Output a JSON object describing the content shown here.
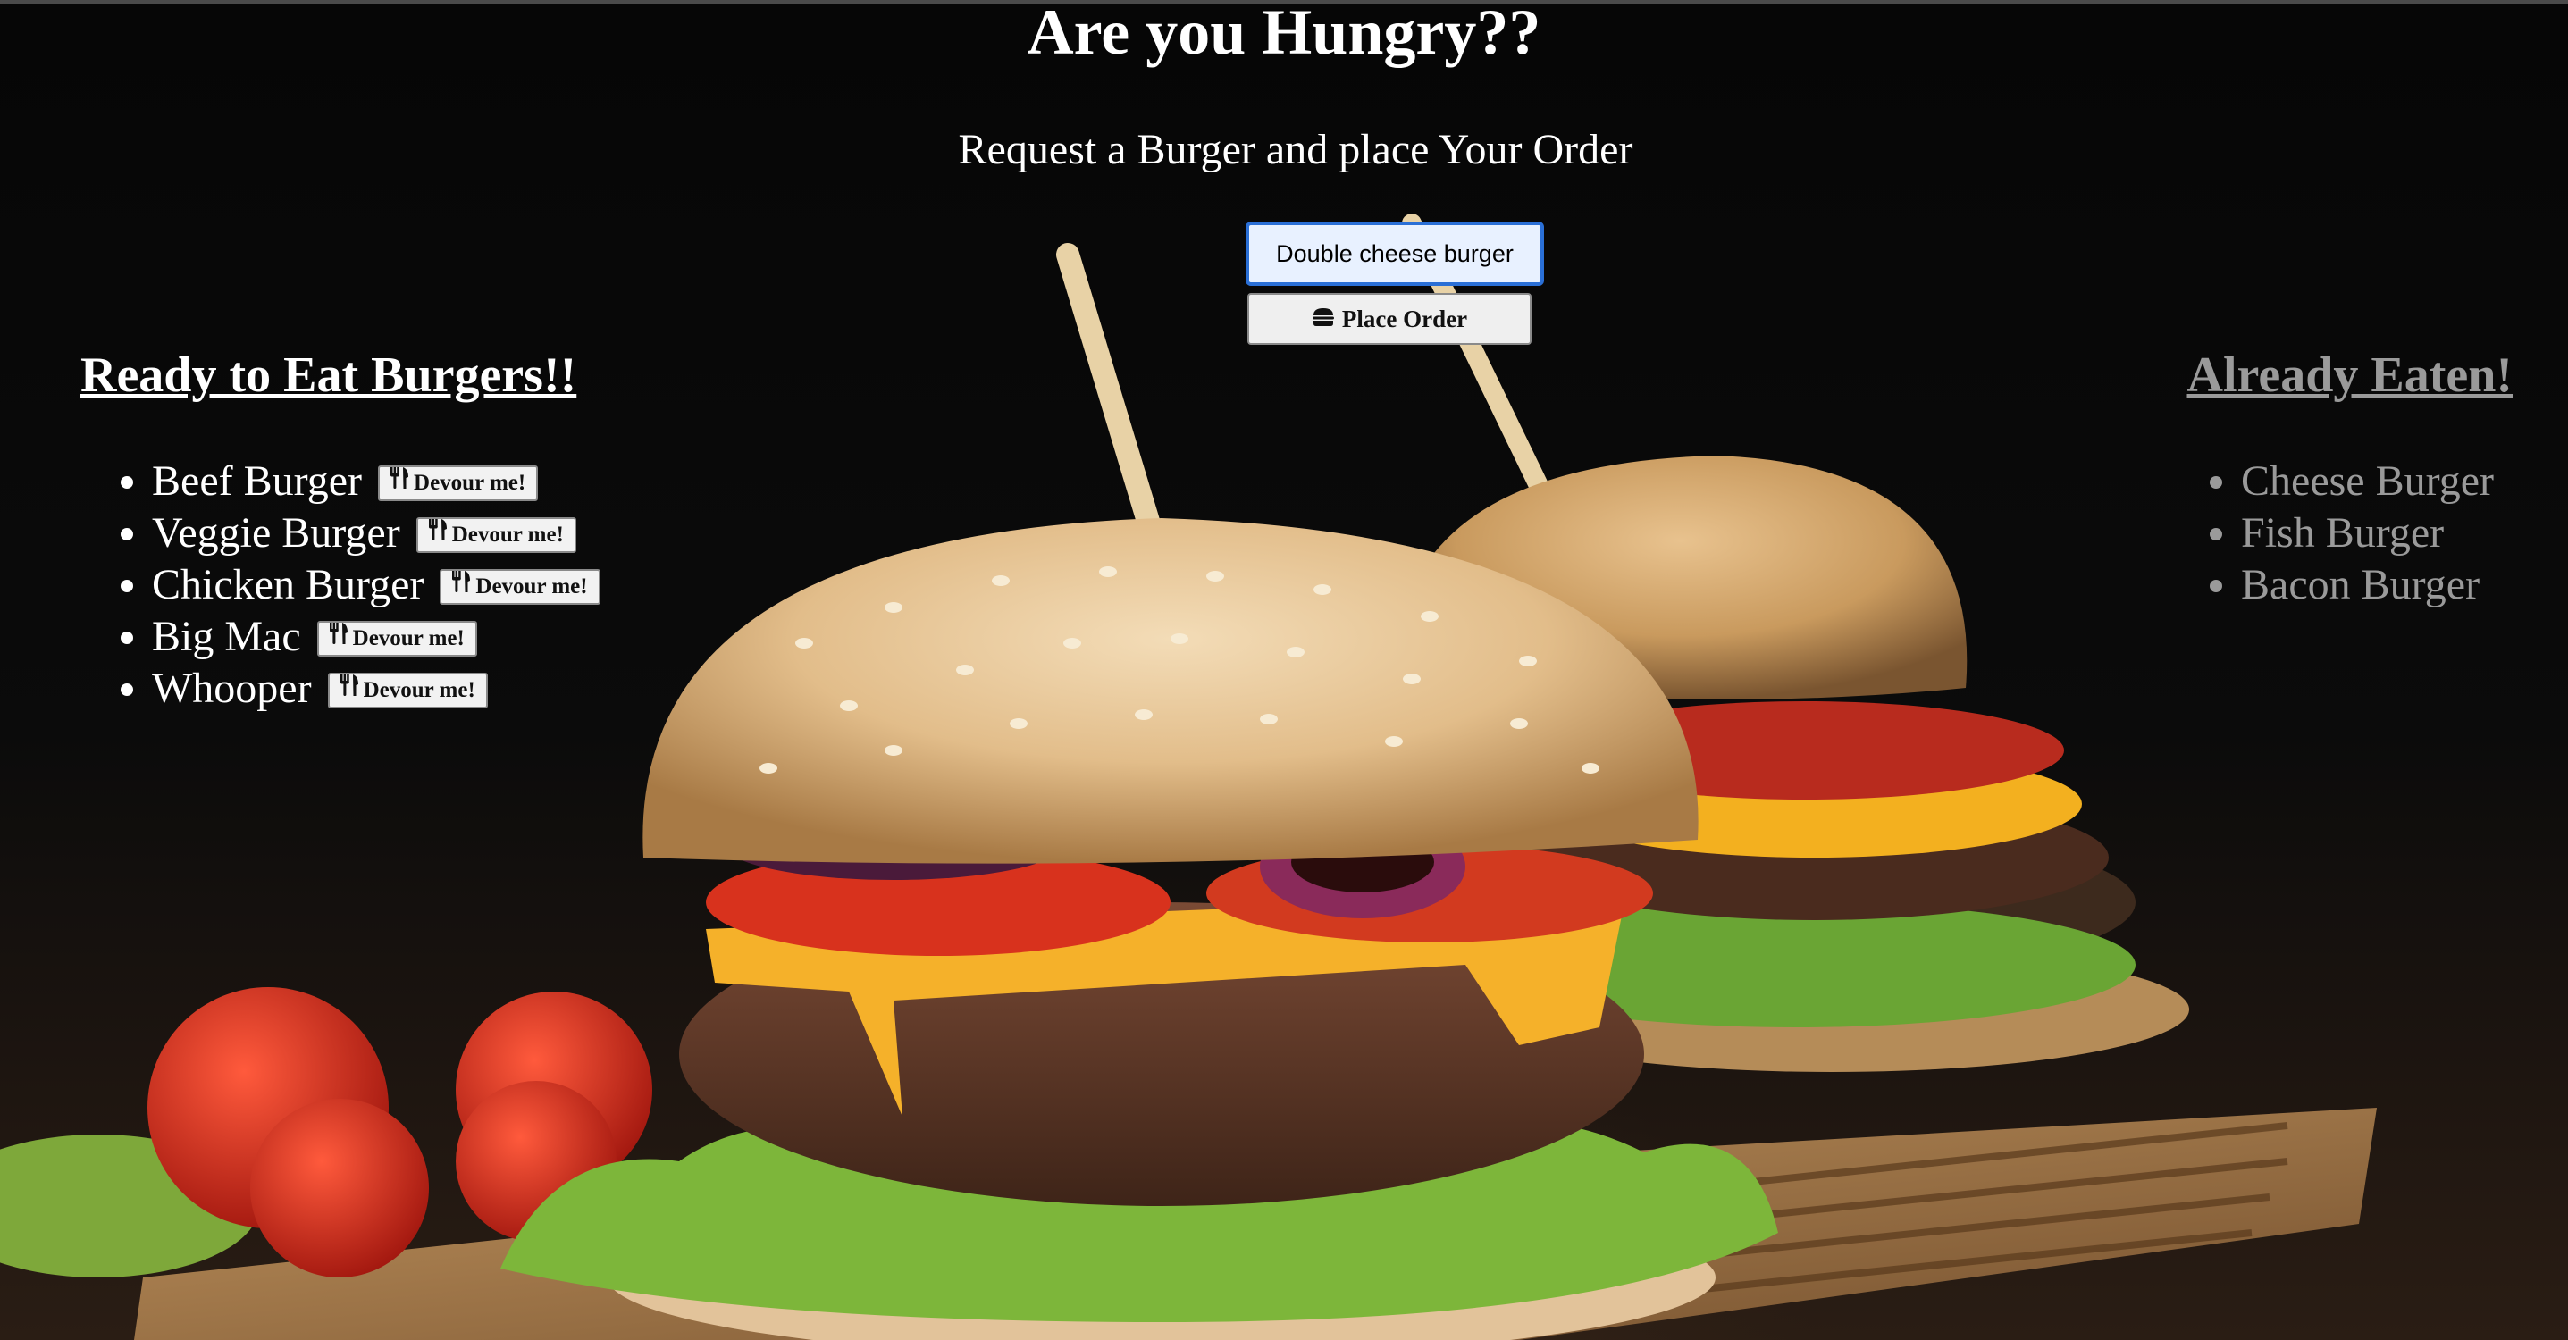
{
  "header": {
    "title": "Are you Hungry??",
    "subtitle": "Request a Burger and place Your Order"
  },
  "order_form": {
    "input_value": "Double cheese burger",
    "button_label": "Place Order",
    "button_icon": "hamburger-icon"
  },
  "ready": {
    "heading": "Ready to Eat Burgers!!",
    "devour_label": "Devour me!",
    "devour_icon": "utensils-icon",
    "items": [
      {
        "name": "Beef Burger"
      },
      {
        "name": "Veggie Burger"
      },
      {
        "name": "Chicken Burger"
      },
      {
        "name": "Big Mac"
      },
      {
        "name": "Whooper"
      }
    ]
  },
  "eaten": {
    "heading": "Already Eaten!",
    "items": [
      {
        "name": "Cheese Burger"
      },
      {
        "name": "Fish Burger"
      },
      {
        "name": "Bacon Burger"
      }
    ]
  },
  "colors": {
    "background": "#050505",
    "text": "#ffffff",
    "eaten_text": "#9a9a9a",
    "input_border": "#2a6fd6"
  }
}
